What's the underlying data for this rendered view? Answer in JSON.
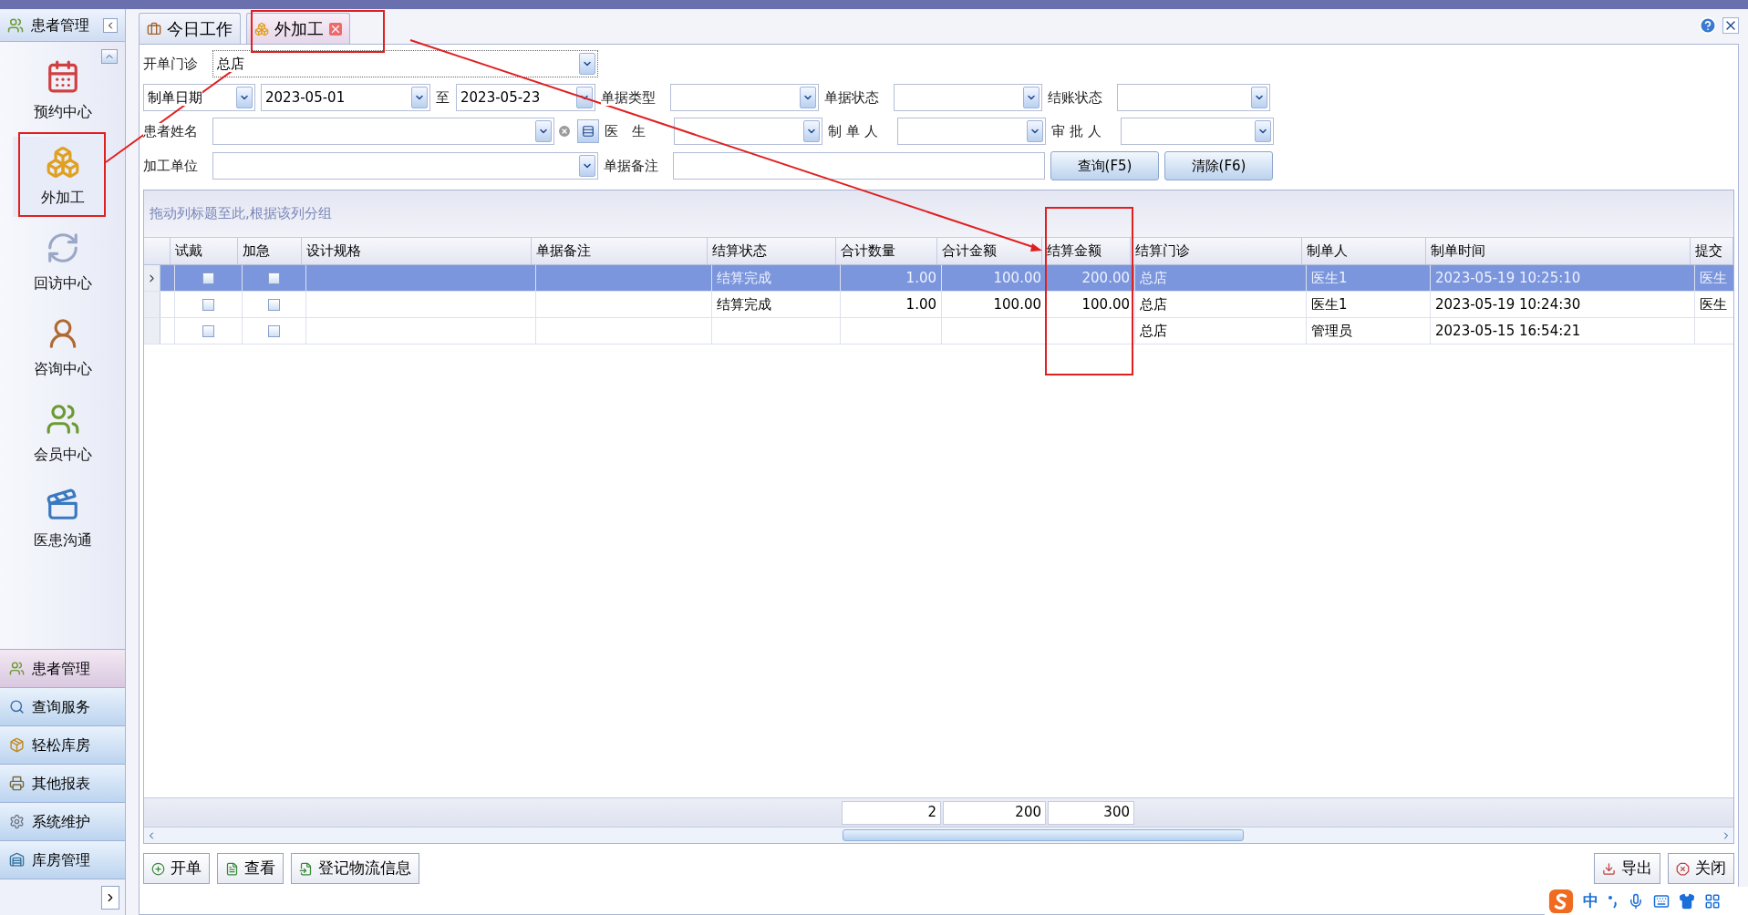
{
  "sidebar": {
    "header": "患者管理",
    "items": [
      {
        "label": "预约中心",
        "selected": false
      },
      {
        "label": "外加工",
        "selected": true
      },
      {
        "label": "回访中心",
        "selected": false
      },
      {
        "label": "咨询中心",
        "selected": false
      },
      {
        "label": "会员中心",
        "selected": false
      },
      {
        "label": "医患沟通",
        "selected": false
      }
    ],
    "nav": [
      {
        "label": "患者管理",
        "selected": true
      },
      {
        "label": "查询服务",
        "selected": false
      },
      {
        "label": "轻松库房",
        "selected": false
      },
      {
        "label": "其他报表",
        "selected": false
      },
      {
        "label": "系统维护",
        "selected": false
      },
      {
        "label": "库房管理",
        "selected": false
      }
    ]
  },
  "tabs": [
    {
      "label": "今日工作",
      "selected": false
    },
    {
      "label": "外加工",
      "selected": true
    }
  ],
  "filters": {
    "clinic": {
      "label": "开单门诊",
      "value": "总店"
    },
    "date_type": "制单日期",
    "date_from": "2023-05-01",
    "date_sep": "至",
    "date_to": "2023-05-23",
    "patient": {
      "label": "患者姓名"
    },
    "unit": {
      "label": "加工单位"
    },
    "doc_type": {
      "label": "单据类型"
    },
    "doctor": {
      "label": "医　生"
    },
    "note": {
      "label": "单据备注"
    },
    "doc_status": {
      "label": "单据状态"
    },
    "maker": {
      "label": "制 单 人"
    },
    "settle_status": {
      "label": "结账状态"
    },
    "approver": {
      "label": "审 批 人"
    },
    "query_button": "查询(F5)",
    "clear_button": "清除(F6)"
  },
  "grid": {
    "group_hint": "拖动列标题至此,根据该列分组",
    "columns": [
      "试戴",
      "加急",
      "设计规格",
      "单据备注",
      "结算状态",
      "合计数量",
      "合计金额",
      "结算金额",
      "结算门诊",
      "制单人",
      "制单时间",
      "提交"
    ],
    "rows": [
      {
        "selected": true,
        "trial": false,
        "urgent": false,
        "cells": [
          null,
          null,
          null,
          null,
          "结算完成",
          "1.00",
          "100.00",
          "200.00",
          "总店",
          "医生1",
          "2023-05-19 10:25:10",
          "医生"
        ]
      },
      {
        "selected": false,
        "trial": false,
        "urgent": false,
        "cells": [
          null,
          null,
          null,
          null,
          "结算完成",
          "1.00",
          "100.00",
          "100.00",
          "总店",
          "医生1",
          "2023-05-19 10:24:30",
          "医生"
        ]
      },
      {
        "selected": false,
        "trial": false,
        "urgent": false,
        "cells": [
          null,
          null,
          null,
          null,
          null,
          null,
          null,
          null,
          "总店",
          "管理员",
          "2023-05-15 16:54:21",
          null
        ]
      }
    ],
    "totals": {
      "quantity": "2",
      "amount": "200",
      "settled_amount": "300"
    }
  },
  "toolbar": {
    "left": [
      "开单",
      "查看",
      "登记物流信息"
    ],
    "right": [
      "导出",
      "关闭"
    ]
  },
  "ime": {
    "mode": "中"
  }
}
